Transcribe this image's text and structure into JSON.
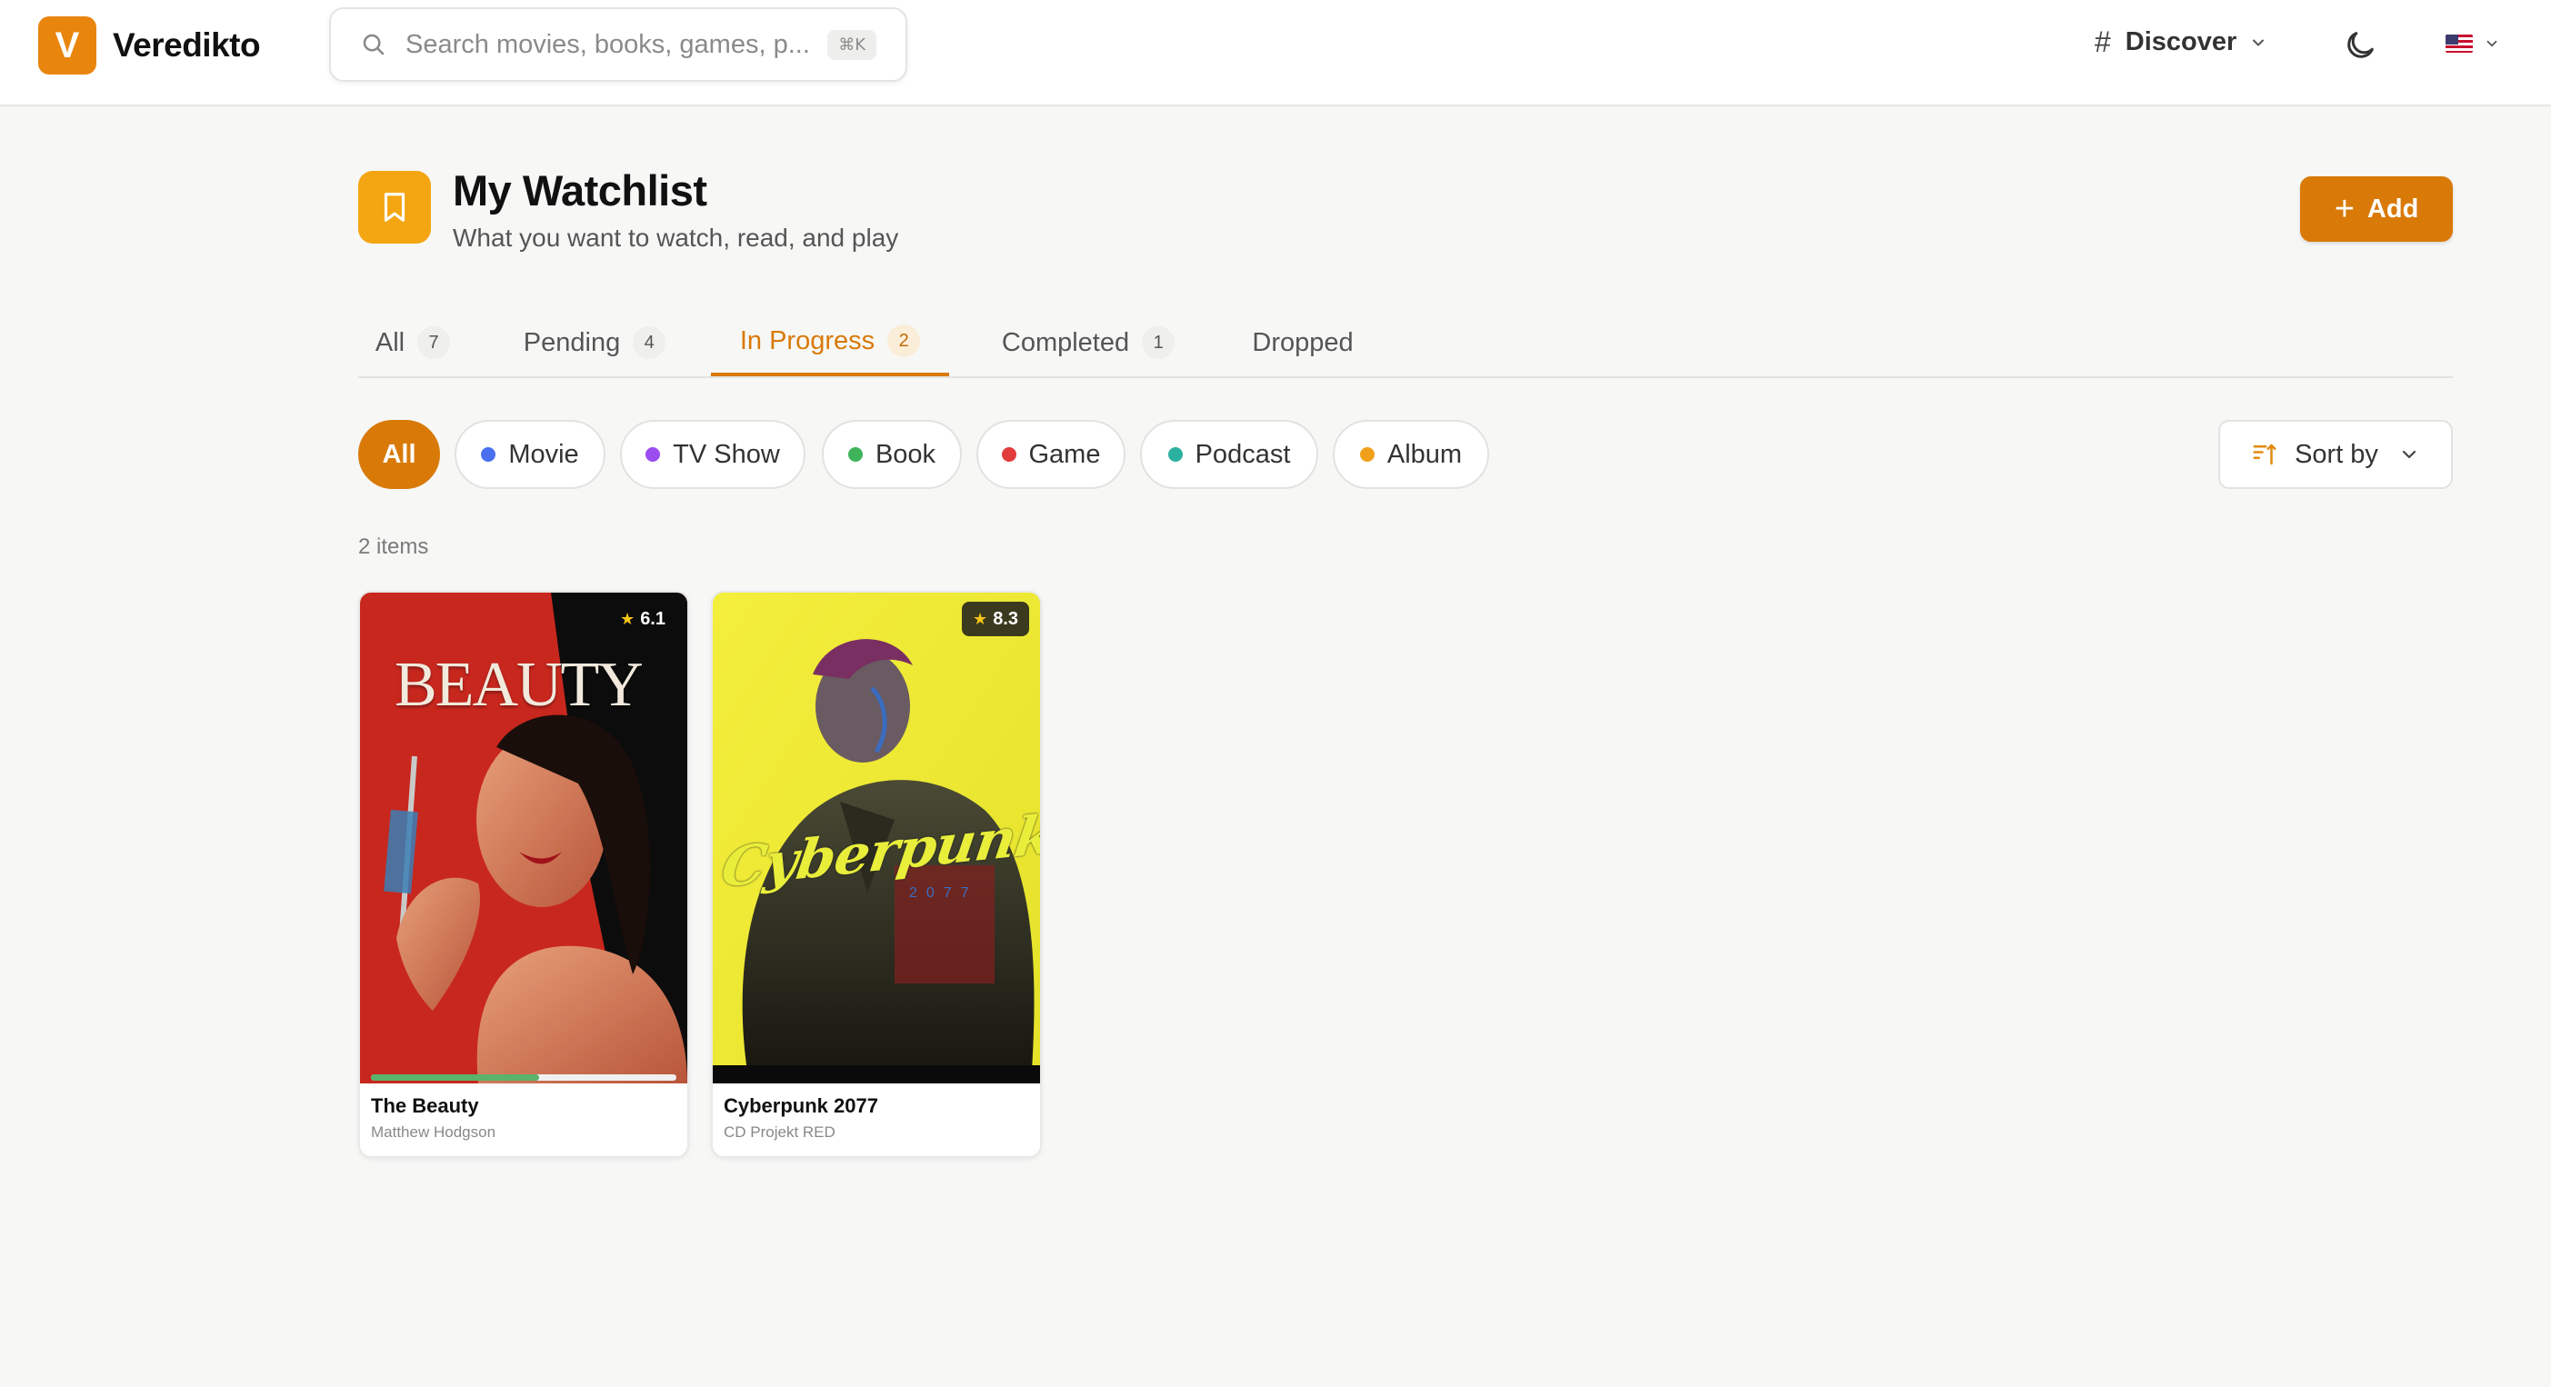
{
  "app": {
    "logo_letter": "V",
    "name": "Veredikto"
  },
  "search": {
    "placeholder": "Search movies, books, games, p...",
    "shortcut": "⌘K"
  },
  "nav": {
    "discover_label": "Discover",
    "language": "en-US"
  },
  "header": {
    "title": "My Watchlist",
    "subtitle": "What you want to watch, read, and play",
    "add_label": "Add"
  },
  "tabs": [
    {
      "label": "All",
      "count": "7"
    },
    {
      "label": "Pending",
      "count": "4"
    },
    {
      "label": "In Progress",
      "count": "2"
    },
    {
      "label": "Completed",
      "count": "1"
    },
    {
      "label": "Dropped",
      "count": ""
    }
  ],
  "active_tab": "In Progress",
  "filters": [
    {
      "label": "All",
      "color": ""
    },
    {
      "label": "Movie",
      "color": "#4a6ff0"
    },
    {
      "label": "TV Show",
      "color": "#9b4df0"
    },
    {
      "label": "Book",
      "color": "#3fb35a"
    },
    {
      "label": "Game",
      "color": "#e23b3b"
    },
    {
      "label": "Podcast",
      "color": "#2bb0a0"
    },
    {
      "label": "Album",
      "color": "#f0a01a"
    }
  ],
  "active_filter": "All",
  "sort": {
    "label": "Sort by"
  },
  "items_count": "2 items",
  "items": [
    {
      "title": "The Beauty",
      "subtitle": "Matthew Hodgson",
      "rating": "6.1",
      "cover_text": "BEAUTY",
      "progress": 0.55
    },
    {
      "title": "Cyberpunk 2077",
      "subtitle": "CD Projekt RED",
      "rating": "8.3",
      "cover_text": "Cyberpunk",
      "cover_subtext": "2077"
    }
  ],
  "colors": {
    "accent": "#d97a08",
    "logo": "#e8850d",
    "page_icon": "#f3a512",
    "background": "#f7f7f6"
  }
}
